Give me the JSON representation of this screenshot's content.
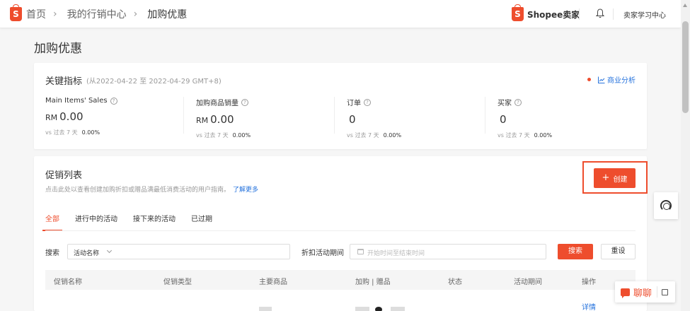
{
  "topbar": {
    "logo_letter": "S",
    "breadcrumb": [
      "首页",
      "我的行销中心",
      "加购优惠"
    ],
    "brand_letter": "S",
    "brand_label": "Shopee卖家",
    "learning_center": "卖家学习中心"
  },
  "page": {
    "title": "加购优惠"
  },
  "metrics": {
    "title": "关键指标",
    "date_range": "(从2022-04-22 至 2022-04-29 GMT+8)",
    "business_analysis": "商业分析",
    "help_glyph": "?",
    "items": [
      {
        "label": "Main Items' Sales",
        "currency": "RM",
        "value": "0.00",
        "compare_label": "vs 过去 7 天",
        "compare_value": "0.00%"
      },
      {
        "label": "加购商品销量",
        "currency": "RM",
        "value": "0.00",
        "compare_label": "vs 过去 7 天",
        "compare_value": "0.00%"
      },
      {
        "label": "订单",
        "currency": "",
        "value": "0",
        "compare_label": "vs 过去 7 天",
        "compare_value": "0.00%"
      },
      {
        "label": "买家",
        "currency": "",
        "value": "0",
        "compare_label": "vs 过去 7 天",
        "compare_value": "0.00%"
      }
    ]
  },
  "promo_list": {
    "title": "促销列表",
    "hint": "点击此处以查看创建加购折扣或赠品满最低消费活动的用户指南。",
    "learn_more": "了解更多",
    "create_plus": "+",
    "create_label": "创建",
    "tabs": [
      "全部",
      "进行中的活动",
      "接下来的活动",
      "已过期"
    ],
    "active_tab": 0,
    "search_label": "搜索",
    "search_field_selected": "活动名称",
    "search_value": "",
    "period_label": "折扣活动期间",
    "period_placeholder": "开始时间至结束时间",
    "search_button": "搜索",
    "reset_button": "重设",
    "columns": [
      "促销名称",
      "促销类型",
      "主要商品",
      "加购 | 赠品",
      "状态",
      "活动期间",
      "操作"
    ],
    "row_action": "详情"
  },
  "floating": {
    "chat_label": "聊聊"
  },
  "colors": {
    "accent": "#ee4d2d",
    "link": "#2673dd"
  },
  "icons": [
    "shopee-bag-icon",
    "chevron-right-icon",
    "bell-icon",
    "help-circle-icon",
    "line-chart-icon",
    "plus-icon",
    "chevron-down-icon",
    "calendar-icon",
    "headset-icon",
    "chat-icon",
    "expand-icon"
  ]
}
